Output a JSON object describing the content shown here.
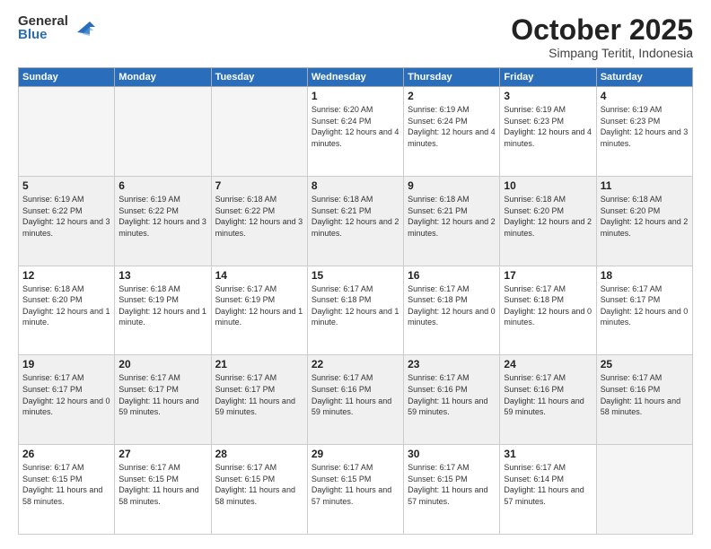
{
  "logo": {
    "general": "General",
    "blue": "Blue"
  },
  "title": "October 2025",
  "location": "Simpang Teritit, Indonesia",
  "days_header": [
    "Sunday",
    "Monday",
    "Tuesday",
    "Wednesday",
    "Thursday",
    "Friday",
    "Saturday"
  ],
  "weeks": [
    {
      "shaded": false,
      "days": [
        {
          "num": "",
          "text": ""
        },
        {
          "num": "",
          "text": ""
        },
        {
          "num": "",
          "text": ""
        },
        {
          "num": "1",
          "text": "Sunrise: 6:20 AM\nSunset: 6:24 PM\nDaylight: 12 hours and 4 minutes."
        },
        {
          "num": "2",
          "text": "Sunrise: 6:19 AM\nSunset: 6:24 PM\nDaylight: 12 hours and 4 minutes."
        },
        {
          "num": "3",
          "text": "Sunrise: 6:19 AM\nSunset: 6:23 PM\nDaylight: 12 hours and 4 minutes."
        },
        {
          "num": "4",
          "text": "Sunrise: 6:19 AM\nSunset: 6:23 PM\nDaylight: 12 hours and 3 minutes."
        }
      ]
    },
    {
      "shaded": true,
      "days": [
        {
          "num": "5",
          "text": "Sunrise: 6:19 AM\nSunset: 6:22 PM\nDaylight: 12 hours and 3 minutes."
        },
        {
          "num": "6",
          "text": "Sunrise: 6:19 AM\nSunset: 6:22 PM\nDaylight: 12 hours and 3 minutes."
        },
        {
          "num": "7",
          "text": "Sunrise: 6:18 AM\nSunset: 6:22 PM\nDaylight: 12 hours and 3 minutes."
        },
        {
          "num": "8",
          "text": "Sunrise: 6:18 AM\nSunset: 6:21 PM\nDaylight: 12 hours and 2 minutes."
        },
        {
          "num": "9",
          "text": "Sunrise: 6:18 AM\nSunset: 6:21 PM\nDaylight: 12 hours and 2 minutes."
        },
        {
          "num": "10",
          "text": "Sunrise: 6:18 AM\nSunset: 6:20 PM\nDaylight: 12 hours and 2 minutes."
        },
        {
          "num": "11",
          "text": "Sunrise: 6:18 AM\nSunset: 6:20 PM\nDaylight: 12 hours and 2 minutes."
        }
      ]
    },
    {
      "shaded": false,
      "days": [
        {
          "num": "12",
          "text": "Sunrise: 6:18 AM\nSunset: 6:20 PM\nDaylight: 12 hours and 1 minute."
        },
        {
          "num": "13",
          "text": "Sunrise: 6:18 AM\nSunset: 6:19 PM\nDaylight: 12 hours and 1 minute."
        },
        {
          "num": "14",
          "text": "Sunrise: 6:17 AM\nSunset: 6:19 PM\nDaylight: 12 hours and 1 minute."
        },
        {
          "num": "15",
          "text": "Sunrise: 6:17 AM\nSunset: 6:18 PM\nDaylight: 12 hours and 1 minute."
        },
        {
          "num": "16",
          "text": "Sunrise: 6:17 AM\nSunset: 6:18 PM\nDaylight: 12 hours and 0 minutes."
        },
        {
          "num": "17",
          "text": "Sunrise: 6:17 AM\nSunset: 6:18 PM\nDaylight: 12 hours and 0 minutes."
        },
        {
          "num": "18",
          "text": "Sunrise: 6:17 AM\nSunset: 6:17 PM\nDaylight: 12 hours and 0 minutes."
        }
      ]
    },
    {
      "shaded": true,
      "days": [
        {
          "num": "19",
          "text": "Sunrise: 6:17 AM\nSunset: 6:17 PM\nDaylight: 12 hours and 0 minutes."
        },
        {
          "num": "20",
          "text": "Sunrise: 6:17 AM\nSunset: 6:17 PM\nDaylight: 11 hours and 59 minutes."
        },
        {
          "num": "21",
          "text": "Sunrise: 6:17 AM\nSunset: 6:17 PM\nDaylight: 11 hours and 59 minutes."
        },
        {
          "num": "22",
          "text": "Sunrise: 6:17 AM\nSunset: 6:16 PM\nDaylight: 11 hours and 59 minutes."
        },
        {
          "num": "23",
          "text": "Sunrise: 6:17 AM\nSunset: 6:16 PM\nDaylight: 11 hours and 59 minutes."
        },
        {
          "num": "24",
          "text": "Sunrise: 6:17 AM\nSunset: 6:16 PM\nDaylight: 11 hours and 59 minutes."
        },
        {
          "num": "25",
          "text": "Sunrise: 6:17 AM\nSunset: 6:16 PM\nDaylight: 11 hours and 58 minutes."
        }
      ]
    },
    {
      "shaded": false,
      "days": [
        {
          "num": "26",
          "text": "Sunrise: 6:17 AM\nSunset: 6:15 PM\nDaylight: 11 hours and 58 minutes."
        },
        {
          "num": "27",
          "text": "Sunrise: 6:17 AM\nSunset: 6:15 PM\nDaylight: 11 hours and 58 minutes."
        },
        {
          "num": "28",
          "text": "Sunrise: 6:17 AM\nSunset: 6:15 PM\nDaylight: 11 hours and 58 minutes."
        },
        {
          "num": "29",
          "text": "Sunrise: 6:17 AM\nSunset: 6:15 PM\nDaylight: 11 hours and 57 minutes."
        },
        {
          "num": "30",
          "text": "Sunrise: 6:17 AM\nSunset: 6:15 PM\nDaylight: 11 hours and 57 minutes."
        },
        {
          "num": "31",
          "text": "Sunrise: 6:17 AM\nSunset: 6:14 PM\nDaylight: 11 hours and 57 minutes."
        },
        {
          "num": "",
          "text": ""
        }
      ]
    }
  ]
}
